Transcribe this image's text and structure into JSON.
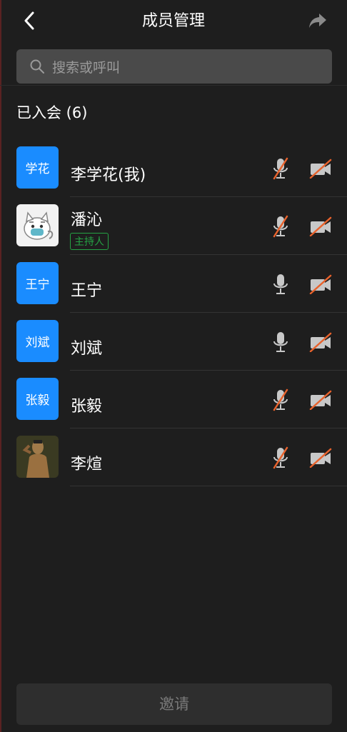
{
  "header": {
    "title": "成员管理",
    "back_icon": "chevron-left-icon",
    "share_icon": "share-forward-icon"
  },
  "search": {
    "placeholder": "搜索或呼叫",
    "icon": "search-icon"
  },
  "section": {
    "title": "已入会 (6)"
  },
  "members": [
    {
      "avatar_text": "学花",
      "name": "李学花(我)",
      "host_label": "",
      "mic_muted": true,
      "camera_off": true
    },
    {
      "avatar_text": "",
      "name": "潘沁",
      "host_label": "主持人",
      "mic_muted": true,
      "camera_off": true,
      "avatar_type": "cartoon-cat-image"
    },
    {
      "avatar_text": "王宁",
      "name": "王宁",
      "host_label": "",
      "mic_muted": false,
      "camera_off": true
    },
    {
      "avatar_text": "刘斌",
      "name": "刘斌",
      "host_label": "",
      "mic_muted": false,
      "camera_off": true
    },
    {
      "avatar_text": "张毅",
      "name": "张毅",
      "host_label": "",
      "mic_muted": true,
      "camera_off": true
    },
    {
      "avatar_text": "",
      "name": "李煊",
      "host_label": "",
      "mic_muted": true,
      "camera_off": true,
      "avatar_type": "person-photo-image"
    }
  ],
  "footer": {
    "invite_label": "邀请"
  },
  "colors": {
    "background": "#1e1e1e",
    "avatar_blue": "#1a8cff",
    "host_green": "#25a244",
    "muted_slash": "#e8622c",
    "icon_gray": "#c8c8c8"
  }
}
